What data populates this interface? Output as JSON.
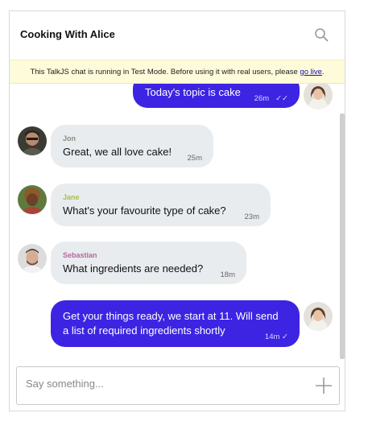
{
  "header": {
    "title": "Cooking With Alice",
    "search_icon": "search-icon"
  },
  "banner": {
    "text": "This TalkJS chat is running in Test Mode. Before using it with real users, please ",
    "link": "go live",
    "suffix": "."
  },
  "messages": [
    {
      "sender": "",
      "text": "Today's topic is cake",
      "time": "26m",
      "status": "✓✓"
    },
    {
      "sender": "Jon",
      "text": "Great, we all love cake!",
      "time": "25m",
      "sender_color": "#8a8f7a"
    },
    {
      "sender": "Jane",
      "text": "What's your favourite type of cake?",
      "time": "23m",
      "sender_color": "#a6c04a"
    },
    {
      "sender": "Sebastian",
      "text": "What ingredients are needed?",
      "time": "18m",
      "sender_color": "#b5679b"
    },
    {
      "sender": "",
      "text_line1": "Get your things ready, we start at 11. Will send",
      "text_line2": "a list of required ingredients shortly",
      "time": "14m",
      "status": "✓"
    }
  ],
  "composer": {
    "placeholder": "Say something...",
    "send_icon": "plus-icon"
  },
  "colors": {
    "outgoing": "#3d24e3",
    "incoming": "#e9ecef",
    "banner": "#fdfbd9"
  }
}
